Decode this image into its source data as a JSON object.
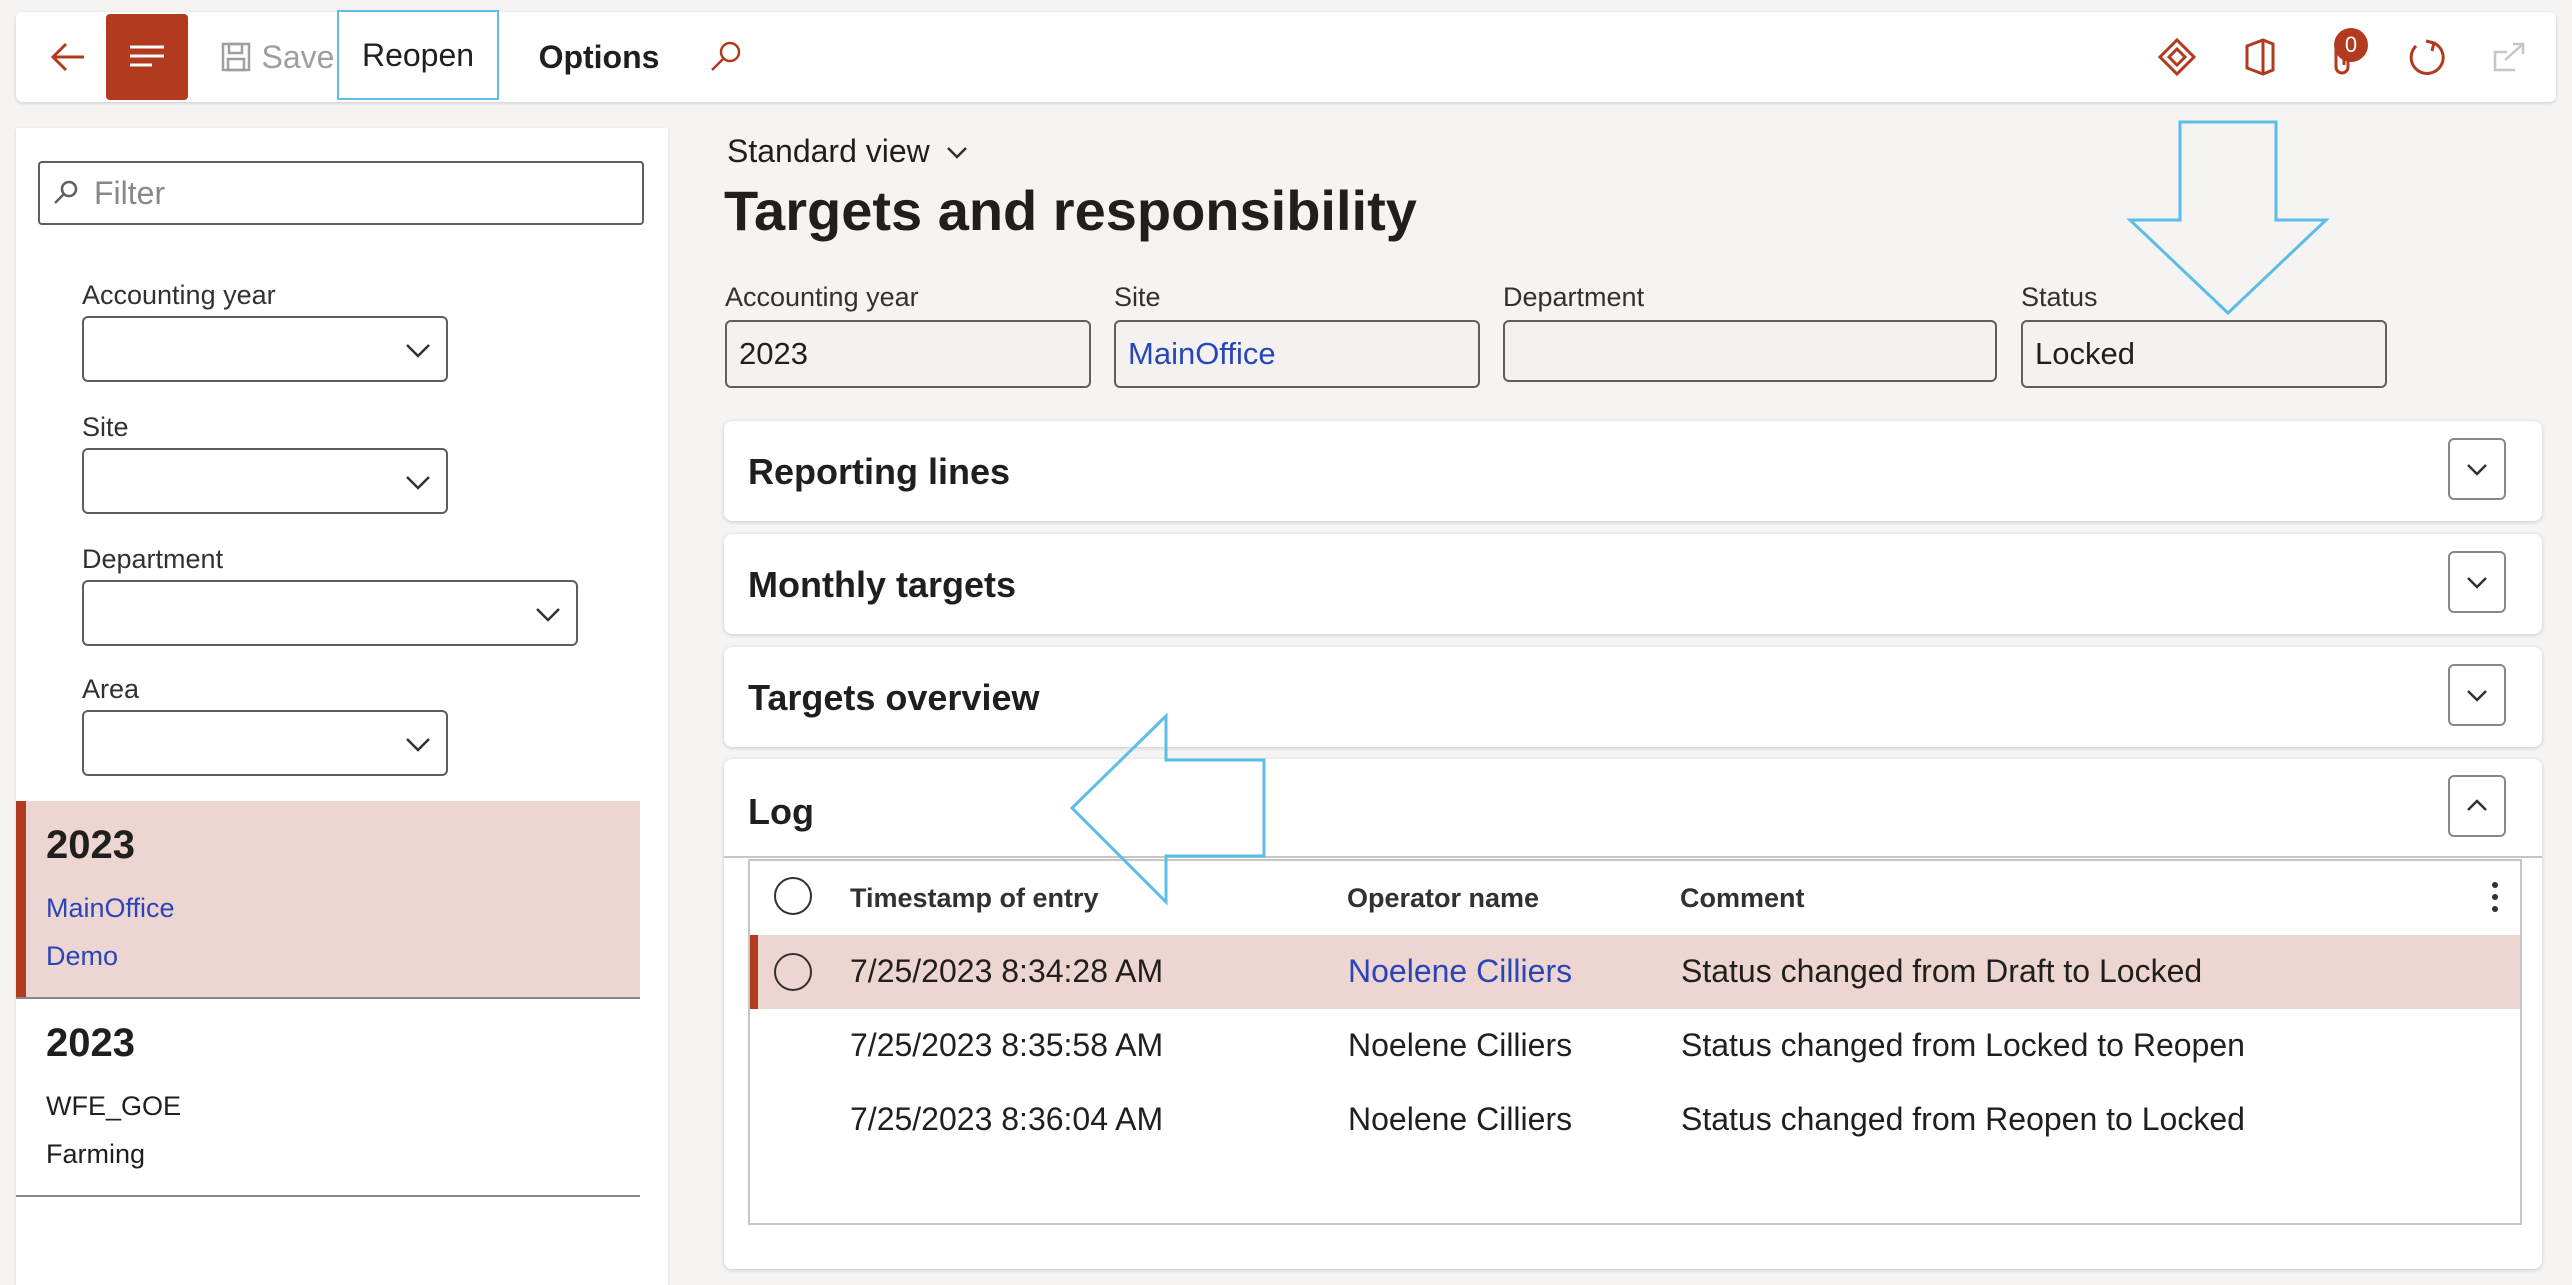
{
  "toolbar": {
    "save_label": "Save",
    "reopen_label": "Reopen",
    "options_label": "Options",
    "attachments_count": "0"
  },
  "filter": {
    "placeholder": "Filter"
  },
  "left_filters": {
    "accounting_year_label": "Accounting year",
    "site_label": "Site",
    "department_label": "Department",
    "area_label": "Area"
  },
  "records": [
    {
      "year": "2023",
      "site": "MainOffice",
      "department": "Demo"
    },
    {
      "year": "2023",
      "site": "WFE_GOE",
      "department": "Farming"
    }
  ],
  "main": {
    "view_selector": "Standard view",
    "title": "Targets and responsibility",
    "fields": {
      "accounting_year_label": "Accounting year",
      "accounting_year_value": "2023",
      "site_label": "Site",
      "site_value": "MainOffice",
      "department_label": "Department",
      "department_value": "",
      "status_label": "Status",
      "status_value": "Locked"
    },
    "sections": [
      {
        "title": "Reporting lines",
        "expanded": false
      },
      {
        "title": "Monthly targets",
        "expanded": false
      },
      {
        "title": "Targets overview",
        "expanded": false
      },
      {
        "title": "Log",
        "expanded": true
      }
    ],
    "log": {
      "columns": [
        "Timestamp of entry",
        "Operator name",
        "Comment"
      ],
      "rows": [
        {
          "timestamp": "7/25/2023 8:34:28 AM",
          "operator": "Noelene Cilliers",
          "comment": "Status changed from Draft to Locked"
        },
        {
          "timestamp": "7/25/2023 8:35:58 AM",
          "operator": "Noelene Cilliers",
          "comment": "Status changed from Locked to Reopen"
        },
        {
          "timestamp": "7/25/2023 8:36:04 AM",
          "operator": "Noelene Cilliers",
          "comment": "Status changed from Reopen to Locked"
        }
      ]
    }
  },
  "colors": {
    "accent": "#b23a1f",
    "link": "#2a45b8",
    "selected_row": "#edd6d1",
    "annotation": "#5bbde8"
  }
}
